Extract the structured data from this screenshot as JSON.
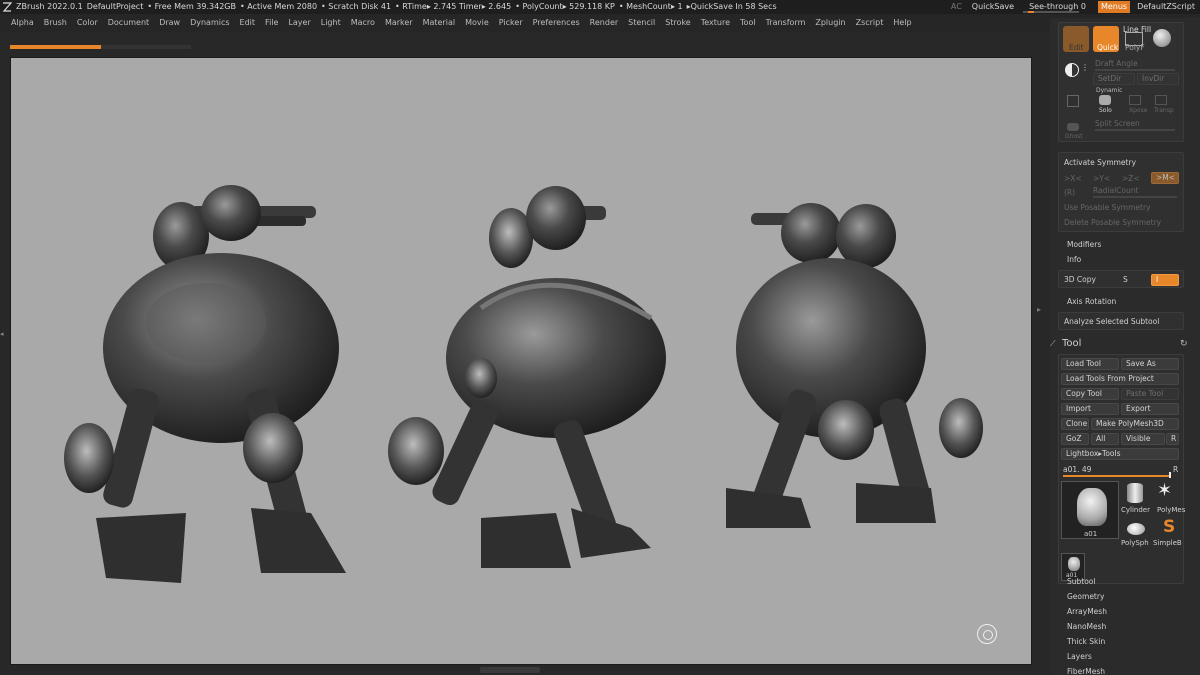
{
  "titlebar": {
    "app": "ZBrush 2022.0.1",
    "project": "DefaultProject",
    "free_mem": "• Free Mem 39.342GB",
    "active_mem": "• Active Mem 2080",
    "scratch": "• Scratch Disk 41",
    "rtime": "• RTime▸ 2.745 Timer▸ 2.645",
    "polycount": "• PolyCount▸ 529.118 KP",
    "meshcount": "• MeshCount▸ 1",
    "quicksave_in": "▸QuickSave In 58 Secs",
    "ac": "AC",
    "quicksave": "QuickSave",
    "seethrough": "See-through  0",
    "menus": "Menus",
    "zscript": "DefaultZScript"
  },
  "menus": [
    "Alpha",
    "Brush",
    "Color",
    "Document",
    "Draw",
    "Dynamics",
    "Edit",
    "File",
    "Layer",
    "Light",
    "Macro",
    "Marker",
    "Material",
    "Movie",
    "Picker",
    "Preferences",
    "Render",
    "Stencil",
    "Stroke",
    "Texture",
    "Tool",
    "Transform",
    "Zplugin",
    "Zscript",
    "Help"
  ],
  "rpanel": {
    "top": {
      "edit_label": "Edit",
      "quick_label": "Quick",
      "linefill_label": "Line Fill",
      "polyf_label": "PolyF",
      "draft_angle": "Draft Angle",
      "setdir": "SetDir",
      "invdir": "InvDir",
      "dynamic": "Dynamic",
      "solo": "Solo",
      "xpose": "Xpose",
      "transp": "Transp",
      "ghost": "Ghost",
      "split_screen": "Split Screen"
    },
    "symmetry": {
      "activate": "Activate Symmetry",
      "x": ">X<",
      "y": ">Y<",
      "z": ">Z<",
      "m": ">M<",
      "r": "(R)",
      "radial": "RadialCount",
      "use_posable": "Use Posable Symmetry",
      "delete_posable": "Delete Posable Symmetry"
    },
    "modifiers": "Modifiers",
    "info": "Info",
    "copy3d": "3D Copy",
    "copy3d_s": "S",
    "copy3d_i": "I",
    "axis_rotation": "Axis Rotation",
    "analyze": "Analyze Selected Subtool",
    "tool": {
      "title": "Tool",
      "load_tool": "Load Tool",
      "save_as": "Save As",
      "load_from_project": "Load Tools From Project",
      "copy_tool": "Copy Tool",
      "paste_tool": "Paste Tool",
      "import": "Import",
      "export": "Export",
      "clone": "Clone",
      "make_polymesh": "Make PolyMesh3D",
      "goz": "GoZ",
      "all": "All",
      "visible": "Visible",
      "r": "R",
      "lightbox": "Lightbox▸Tools",
      "current": "a01. 49",
      "thumb_main": "a01",
      "thumb_small": "a01",
      "cylinder": "Cylinder",
      "polymesh": "PolyMes",
      "polysph": "PolySph",
      "simpleb": "SimpleB"
    },
    "subpalettes": [
      "Subtool",
      "Geometry",
      "ArrayMesh",
      "NanoMesh",
      "Thick Skin",
      "Layers",
      "FiberMesh"
    ]
  },
  "colors": {
    "accent": "#e8872a",
    "viewport_bg": "#a9a9a9"
  }
}
